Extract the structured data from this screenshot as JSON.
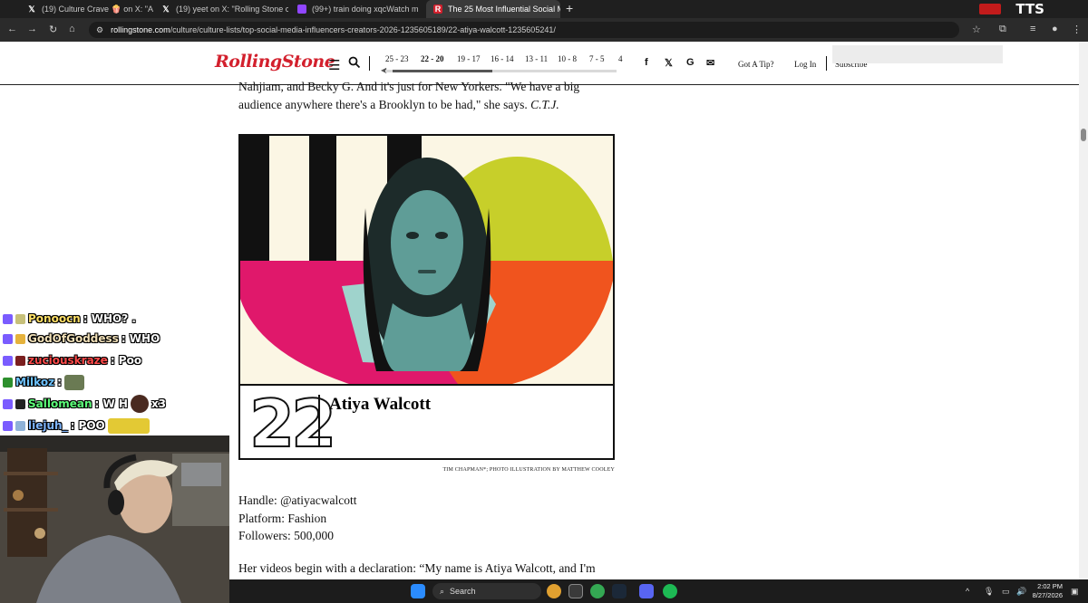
{
  "browser": {
    "tabs": [
      {
        "icon": "x-logo-icon",
        "label": "(19) Culture Crave 🍿 on X: \"A"
      },
      {
        "icon": "x-logo-icon",
        "label": "(19) yeet on X: \"Rolling Stone c"
      },
      {
        "icon": "twitch-icon",
        "label": "(99+) train doing xqcWatch m"
      },
      {
        "icon": "rolling-stone-icon",
        "label": "The 25 Most Influential Social M",
        "active": true
      }
    ],
    "new_tab": "+",
    "tts_label": "TTS",
    "url": {
      "host": "rollingstone.com",
      "path": "/culture/culture-lists/top-social-media-influencers-creators-2026-1235605189/22-atiya-walcott-1235605241/"
    }
  },
  "site_header": {
    "logo": "RollingStone",
    "ranges": [
      "25 - 23",
      "22 - 20",
      "19 - 17",
      "16 - 14",
      "13 - 11",
      "10 - 8",
      "7 - 5",
      "4"
    ],
    "active_range": "22 - 20",
    "social_icons": [
      "facebook-icon",
      "x-logo-icon",
      "google-icon",
      "email-icon"
    ],
    "got_a_tip": "Got A Tip?",
    "log_in": "Log In",
    "subscribe": "Subscribe"
  },
  "article": {
    "p_top_line1": "Nahjiam, and Becky G. And it's just for New Yorkers. \"We have a big",
    "p_top_line2": "audience anywhere there's a Brooklyn to be had,\" she says. ",
    "p_top_initials": "C.T.J.",
    "rank": "22",
    "name": "Atiya Walcott",
    "photo_credit": "TIM CHAPMAN*; PHOTO ILLUSTRATION BY MATTHEW COOLEY",
    "handle": "Handle: @atiyacwalcott",
    "platform": "Platform: Fashion",
    "followers": "Followers: 500,000",
    "p_bottom": "Her videos begin with a declaration: “My name is Atiya Walcott, and I'm"
  },
  "chat": [
    {
      "user": "Ponoocn",
      "message": ": WHO? ."
    },
    {
      "user": "GodOfGoddess",
      "message": ": WHO"
    },
    {
      "user": "zuciouskraze",
      "message": ": Poo"
    },
    {
      "user": "Milkoz",
      "message": ":"
    },
    {
      "user": "Sallomean",
      "message": ": W H",
      "suffix": "x3"
    },
    {
      "user": "liejuh_",
      "message": ": POO"
    }
  ],
  "colors": {
    "rs_red": "#d3202d",
    "art_yellow": "#c7cf2a",
    "art_magenta": "#e0186b",
    "art_orange": "#f0541e",
    "art_teal": "#6fb4ad"
  },
  "taskbar": {
    "search_placeholder": "Search",
    "time": "2:02 PM",
    "date": "8/27/2026"
  }
}
